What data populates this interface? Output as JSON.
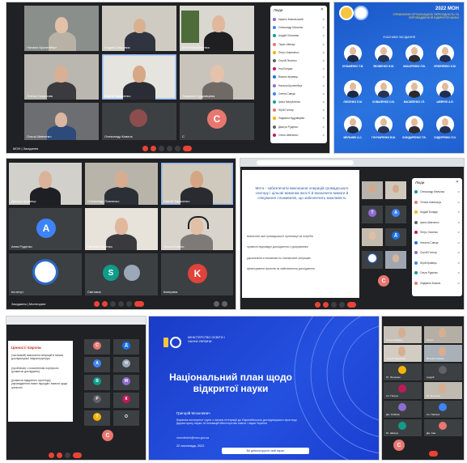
{
  "shot1": {
    "tiles": [
      {
        "name": "Наталія Кроненберг"
      },
      {
        "name": "Андрій Ольховик"
      },
      {
        "name": "Ірина Мануйленко"
      },
      {
        "name": "Олена Смирнова"
      },
      {
        "name": "Сергій Тарасенко"
      },
      {
        "name": "Людмила Кудрявцева"
      },
      {
        "name": "Ольга Шевченко"
      },
      {
        "name": "Олександр Коваль"
      },
      {
        "name": "С"
      }
    ],
    "avatar_letter": "С",
    "footer": "МОН | Засідання",
    "panel_title": "Люди",
    "participants": [
      "Кирило Ковальський",
      "Олександр Мельник",
      "Андрій Ольховик",
      "Тарас Шевчук",
      "Петро Коваленко",
      "Сергій Лисенко",
      "Ігор Бондар",
      "Василь Кравець",
      "Наталія Кроненберг",
      "Олена Савчук",
      "Ірина Мануйленко",
      "Юрій Гончар",
      "Людмила Кудрявцева",
      "Дмитро Руденко",
      "Ольга Шевченко"
    ]
  },
  "shot2": {
    "title": "2022 МОН",
    "subtitle": "УПРАВЛІННЯ ОРГАНІЗАЦІЄЮ ПЕРЕХІДНІСТЬ ТА ВПРОВАДЖЕННЯ ВІДКРИТОЇ НАУКИ",
    "caption": "УЧАСНИКИ ЗАСІДАННЯ",
    "people": [
      {
        "name": "КУЗЬМЕНКО Т.В."
      },
      {
        "name": "ЯКОВЕНКО Н.М."
      },
      {
        "name": "МАКАРЕНКО Л.В."
      },
      {
        "name": "КРАВЧЕНКО О.М."
      },
      {
        "name": "ЛИСЕНКО Л.М."
      },
      {
        "name": "КОВАЛЕНКО О.В."
      },
      {
        "name": "ВАСИЛЕНКО І.П."
      },
      {
        "name": "ШЕВЧУК А.Я."
      },
      {
        "name": "МЕЛЬНИК А.С."
      },
      {
        "name": "ГОНЧАРЕНКО В.М."
      },
      {
        "name": "БОНДАРЕНКО Т.В."
      },
      {
        "name": "СИДОРЕНКО Л.О."
      }
    ]
  },
  "shot3": {
    "tiles": [
      {
        "name": "Дмитро Кравець"
      },
      {
        "name": "Олександр Павленко"
      },
      {
        "name": "Сергій Тарасенко"
      },
      {
        "name": "Анна Руденко"
      },
      {
        "name": "Наталія Лисенко"
      },
      {
        "name": "Ольга Коваль"
      },
      {
        "name": "Інститут"
      },
      {
        "name": "Світлана"
      },
      {
        "name": "Катерина"
      }
    ],
    "avatar_a": "A",
    "avatar_s": "S",
    "avatar_k": "K",
    "footer": "Засідання | Моніторинг"
  },
  "shot4": {
    "slide_text": "Мета - забезпечити виконання операцій громадського сектору і цільові вимогам якості й визначити вимоги й очікування споживачів, що забезпечить можливість",
    "bullets": [
      "визначити якої громадськості організації за потреби",
      "провести відповідні дослідження з урахуванням",
      "удосконалити показники по тимчасових операціях",
      "фінансування проектів за забезпечення дослідження"
    ],
    "panel_title": "Люди",
    "avatar_letter": "С",
    "participants": [
      "Олександр Мельник",
      "Тетяна Ковальчук",
      "Андрій Бондар",
      "Ірина Шевченко",
      "Петро Лисенко",
      "Наталія Савчук",
      "Сергій Гончар",
      "Юрій Кравець",
      "Ольга Руденко",
      "Людмила Коваль"
    ]
  },
  "shot5": {
    "heading": "Цінності Європи",
    "bullets": [
      "(частковий) виконання операцій в межах дослідницької інфраструктури",
      "(проблема): з посиленням портфоліо (розвиток досліджень)",
      "(розвиток відкритого простору): упровадження нових підходів і вимоги щодо ціннісної"
    ],
    "avatar_letter": "С",
    "letters": [
      "С",
      "Д",
      "А",
      "Н",
      "В",
      "М",
      "Р",
      "К",
      "Т",
      "О"
    ]
  },
  "shot6": {
    "ministry": "МІНІСТЕРСТВО ОСВІТИ І НАУКИ УКРАЇНИ",
    "title": "Національний план щодо відкритої науки",
    "speaker": "Григорій Мозолевич",
    "role": "Керівник експертної групи з питань інтеграції до Європейського дослідницького простору Директорату науки та інновацій Міністерства освіти і науки України",
    "email": "mozolevich@mon.gov.ua",
    "date": "22 листопада, 2022",
    "screen_share": "Ви демонструєте свій екран"
  },
  "shot7": {
    "tiles": [
      {
        "name": "Ольга Кравець"
      },
      {
        "name": "Петро"
      },
      {
        "name": "Сергій Тарасенко"
      },
      {
        "name": "Віталій Олійник"
      },
      {
        "name": "Ю. Петренко"
      },
      {
        "name": "Андрій"
      },
      {
        "name": "Ал. Петрук"
      },
      {
        "name": "Ю. Мельник"
      },
      {
        "name": "Дж. Олійник"
      },
      {
        "name": "Ал. Павлюк"
      },
      {
        "name": "Ю. Шевчук"
      },
      {
        "name": "Дж. Сав"
      }
    ],
    "avatar_letter": "С"
  }
}
